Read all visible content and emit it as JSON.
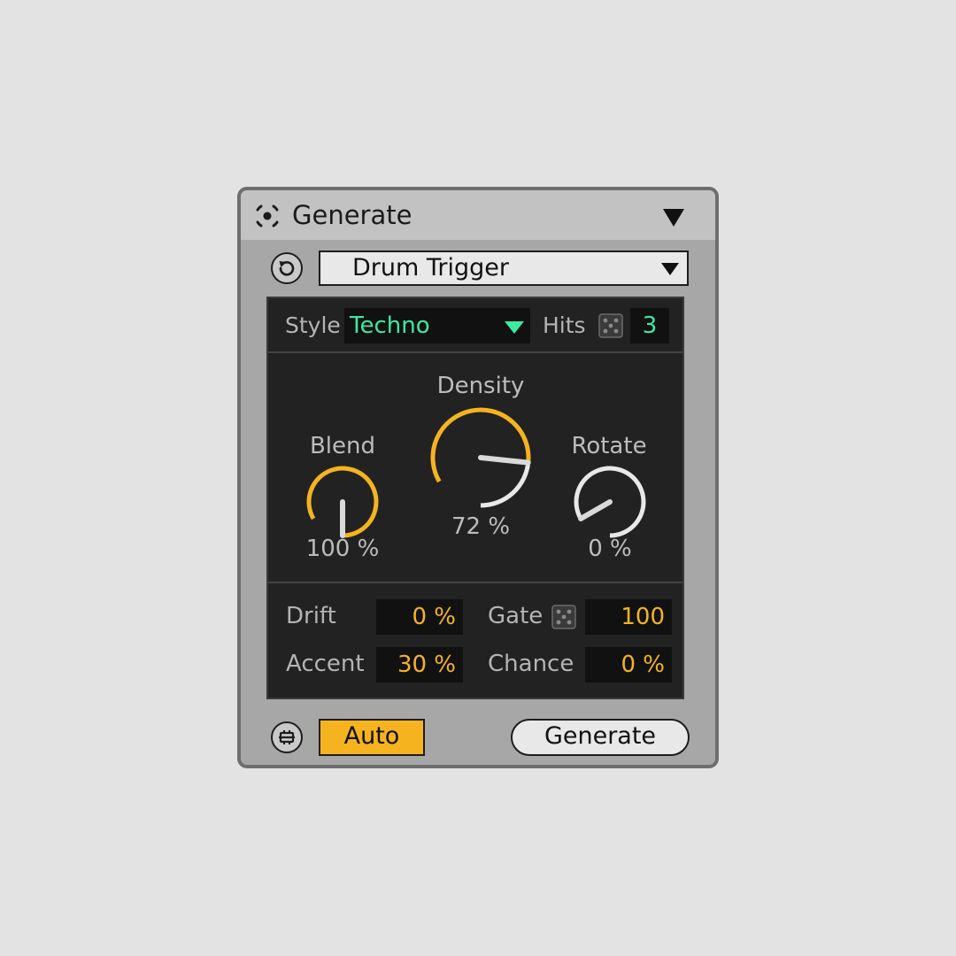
{
  "device": {
    "title": "Generate",
    "title_icon": "target-dot-icon",
    "collapse_icon": "triangle-down-icon"
  },
  "preset": {
    "reset_icon": "reset-circle-arrow-icon",
    "selected": "Drum Trigger",
    "arrow_icon": "triangle-down-icon"
  },
  "panel": {
    "style_label": "Style",
    "style_value": "Techno",
    "hits_label": "Hits",
    "hits_value": "3",
    "dice_icon": "dice-icon",
    "knobs": {
      "blend": {
        "label": "Blend",
        "value_text": "100 %",
        "value": 1.0
      },
      "density": {
        "label": "Density",
        "value_text": "72 %",
        "value": 0.72
      },
      "rotate": {
        "label": "Rotate",
        "value_text": "0 %",
        "value": 0.0
      }
    },
    "drift_label": "Drift",
    "drift_value": "0 %",
    "gate_label": "Gate",
    "gate_value": "100",
    "accent_label": "Accent",
    "accent_value": "30 %",
    "chance_label": "Chance",
    "chance_value": "0 %"
  },
  "footer": {
    "loop_icon": "clip-loop-icon",
    "auto_label": "Auto",
    "generate_label": "Generate"
  },
  "colors": {
    "accent_orange": "#f5b320",
    "accent_green": "#3ee8a2",
    "panel_bg": "#222222",
    "device_bg": "#a7a7a7"
  }
}
